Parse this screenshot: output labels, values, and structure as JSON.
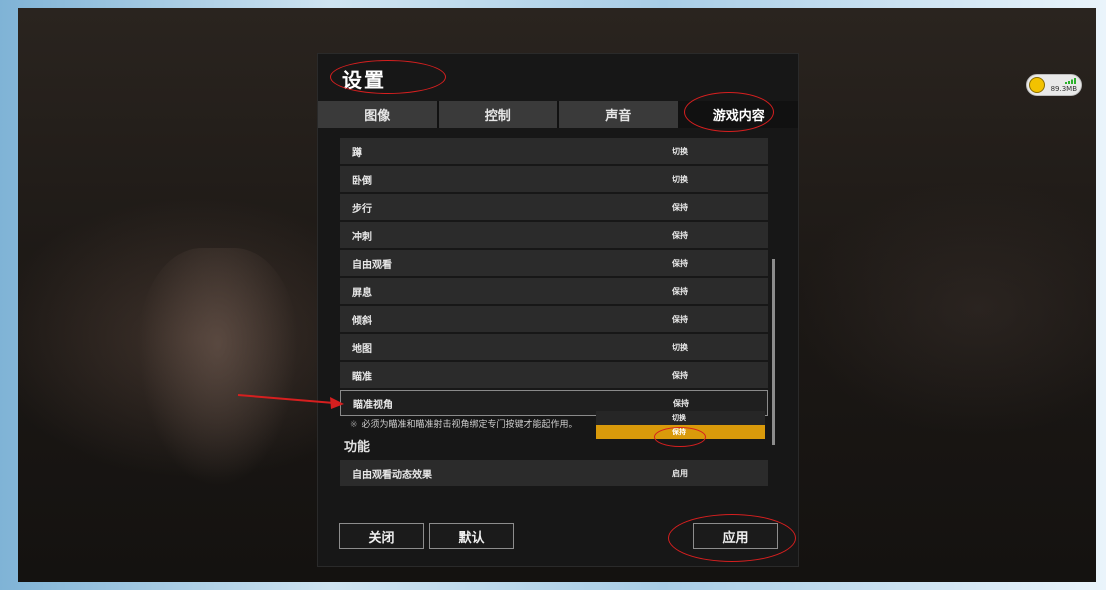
{
  "window": {
    "title": "设置"
  },
  "tabs": [
    {
      "label": "图像",
      "active": false
    },
    {
      "label": "控制",
      "active": false
    },
    {
      "label": "声音",
      "active": false
    },
    {
      "label": "游戏内容",
      "active": true
    }
  ],
  "list": {
    "rows": [
      {
        "label": "蹲",
        "value": "切换"
      },
      {
        "label": "卧倒",
        "value": "切换"
      },
      {
        "label": "步行",
        "value": "保持"
      },
      {
        "label": "冲刺",
        "value": "保持"
      },
      {
        "label": "自由观看",
        "value": "保持"
      },
      {
        "label": "屏息",
        "value": "保持"
      },
      {
        "label": "倾斜",
        "value": "保持"
      },
      {
        "label": "地图",
        "value": "切换"
      },
      {
        "label": "瞄准",
        "value": "保持"
      },
      {
        "label": "瞄准视角",
        "value": "保持",
        "selected": true
      }
    ],
    "note": "必须为瞄准和瞄准射击视角绑定专门按键才能起作用。",
    "note_mark": "※",
    "dropdown_options": [
      "切换",
      "保持"
    ],
    "dropdown_selected": "保持"
  },
  "section": {
    "title": "功能",
    "rows": [
      {
        "label": "自由观看动态效果",
        "value": "启用"
      }
    ]
  },
  "buttons": {
    "close": "关闭",
    "default": "默认",
    "apply": "应用"
  },
  "net_widget": {
    "speed": "89.3MB"
  },
  "colors": {
    "accent": "#d99a0b",
    "annotation": "#d61f1f",
    "panel_bg": "#171717",
    "row_bg": "#2b2b2b"
  }
}
